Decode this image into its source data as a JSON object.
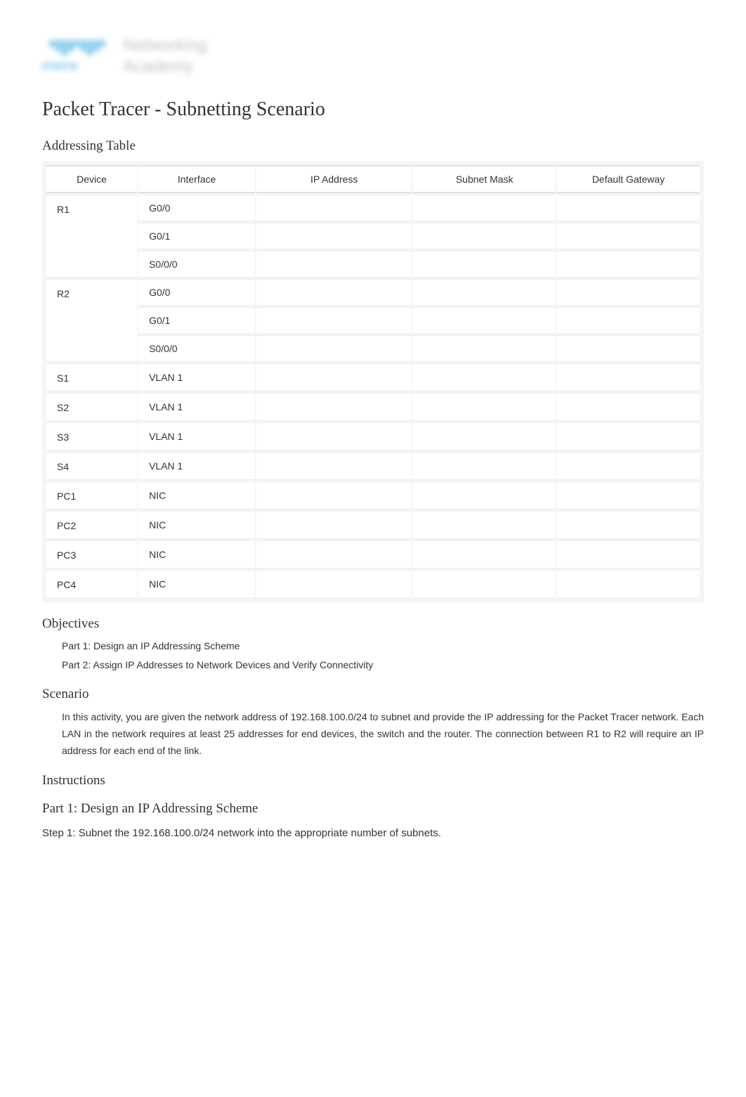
{
  "logo": {
    "brand": "cisco",
    "line1": "Networking",
    "line2": "Academy"
  },
  "title": "Packet Tracer - Subnetting Scenario",
  "addressing_table": {
    "heading": "Addressing Table",
    "headers": {
      "device": "Device",
      "interface": "Interface",
      "ip": "IP Address",
      "mask": "Subnet Mask",
      "gateway": "Default Gateway"
    },
    "rows": [
      {
        "device": "R1",
        "rowspan": 3,
        "interface": "G0/0",
        "ip": "",
        "mask": "",
        "gateway": ""
      },
      {
        "device": "",
        "interface": "G0/1",
        "ip": "",
        "mask": "",
        "gateway": ""
      },
      {
        "device": "",
        "interface": "S0/0/0",
        "ip": "",
        "mask": "",
        "gateway": ""
      },
      {
        "device": "R2",
        "rowspan": 3,
        "interface": "G0/0",
        "ip": "",
        "mask": "",
        "gateway": ""
      },
      {
        "device": "",
        "interface": "G0/1",
        "ip": "",
        "mask": "",
        "gateway": ""
      },
      {
        "device": "",
        "interface": "S0/0/0",
        "ip": "",
        "mask": "",
        "gateway": ""
      },
      {
        "device": "S1",
        "rowspan": 1,
        "interface": "VLAN 1",
        "ip": "",
        "mask": "",
        "gateway": ""
      },
      {
        "device": "S2",
        "rowspan": 1,
        "interface": "VLAN 1",
        "ip": "",
        "mask": "",
        "gateway": ""
      },
      {
        "device": "S3",
        "rowspan": 1,
        "interface": "VLAN 1",
        "ip": "",
        "mask": "",
        "gateway": ""
      },
      {
        "device": "S4",
        "rowspan": 1,
        "interface": "VLAN 1",
        "ip": "",
        "mask": "",
        "gateway": ""
      },
      {
        "device": "PC1",
        "rowspan": 1,
        "interface": "NIC",
        "ip": "",
        "mask": "",
        "gateway": ""
      },
      {
        "device": "PC2",
        "rowspan": 1,
        "interface": "NIC",
        "ip": "",
        "mask": "",
        "gateway": ""
      },
      {
        "device": "PC3",
        "rowspan": 1,
        "interface": "NIC",
        "ip": "",
        "mask": "",
        "gateway": ""
      },
      {
        "device": "PC4",
        "rowspan": 1,
        "interface": "NIC",
        "ip": "",
        "mask": "",
        "gateway": ""
      }
    ]
  },
  "objectives": {
    "heading": "Objectives",
    "items": [
      "Part 1: Design an IP Addressing Scheme",
      "Part 2: Assign IP Addresses to Network Devices and Verify Connectivity"
    ]
  },
  "scenario": {
    "heading": "Scenario",
    "text": "In this activity, you are given the network address of 192.168.100.0/24 to subnet and provide the IP addressing for the Packet Tracer network. Each LAN in the network requires at least 25 addresses for end devices, the switch and the router. The connection between R1 to R2 will require an IP address for each end of the link."
  },
  "instructions": {
    "heading": "Instructions"
  },
  "part1": {
    "heading": "Part 1: Design an IP Addressing Scheme",
    "step1": "Step 1: Subnet the 192.168.100.0/24 network into the appropriate number of subnets."
  }
}
